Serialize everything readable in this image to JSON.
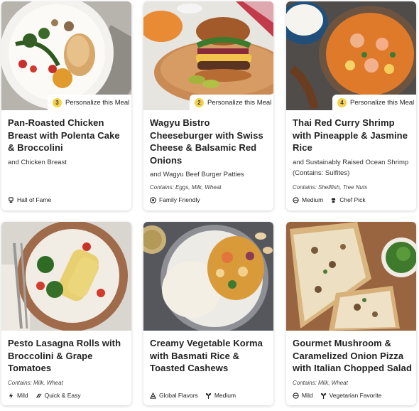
{
  "meals": [
    {
      "title": "Pan-Roasted Chicken Breast with Polenta Cake & Broccolini",
      "subtitle": "and Chicken Breast",
      "personalize_num": "3",
      "personalize_label": "Personalize this Meal",
      "contains": "",
      "tags": [
        {
          "icon": "trophy-icon",
          "label": "Hall of Fame"
        }
      ]
    },
    {
      "title": "Wagyu Bistro Cheeseburger with Swiss Cheese & Balsamic Red Onions",
      "subtitle": "and Wagyu Beef Burger Patties",
      "personalize_num": "2",
      "personalize_label": "Personalize this Meal",
      "contains": "Contains: Eggs, Milk, Wheat",
      "tags": [
        {
          "icon": "family-icon",
          "label": "Family Friendly"
        }
      ]
    },
    {
      "title": "Thai Red Curry Shrimp with Pineapple & Jasmine Rice",
      "subtitle": "and Sustainably Raised Ocean Shrimp (Contains: Sulfites)",
      "personalize_num": "4",
      "personalize_label": "Personalize this Meal",
      "contains": "Contains: Shellfish, Tree Nuts",
      "tags": [
        {
          "icon": "spice-icon",
          "label": "Medium"
        },
        {
          "icon": "chef-hat-icon",
          "label": "Chef Pick"
        }
      ]
    },
    {
      "title": "Pesto Lasagna Rolls with Broccolini & Grape Tomatoes",
      "subtitle": "",
      "contains": "Contains: Milk, Wheat",
      "tags": [
        {
          "icon": "lightning-icon",
          "label": "Mild"
        },
        {
          "icon": "quick-icon",
          "label": "Quick & Easy"
        }
      ]
    },
    {
      "title": "Creamy Vegetable Korma with Basmati Rice & Toasted Cashews",
      "subtitle": "",
      "contains": "",
      "tags": [
        {
          "icon": "globe-icon",
          "label": "Global Flavors"
        },
        {
          "icon": "sprout-icon",
          "label": "Medium"
        }
      ]
    },
    {
      "title": "Gourmet Mushroom & Caramelized Onion Pizza with Italian Chopped Salad",
      "subtitle": "",
      "contains": "Contains: Milk, Wheat",
      "tags": [
        {
          "icon": "spice-icon",
          "label": "Mild"
        },
        {
          "icon": "sprout-icon",
          "label": "Vegetarian Favorite"
        }
      ]
    }
  ],
  "colors": {
    "badge": "#f4d24a",
    "card_bg": "#ffffff",
    "text": "#222222"
  }
}
